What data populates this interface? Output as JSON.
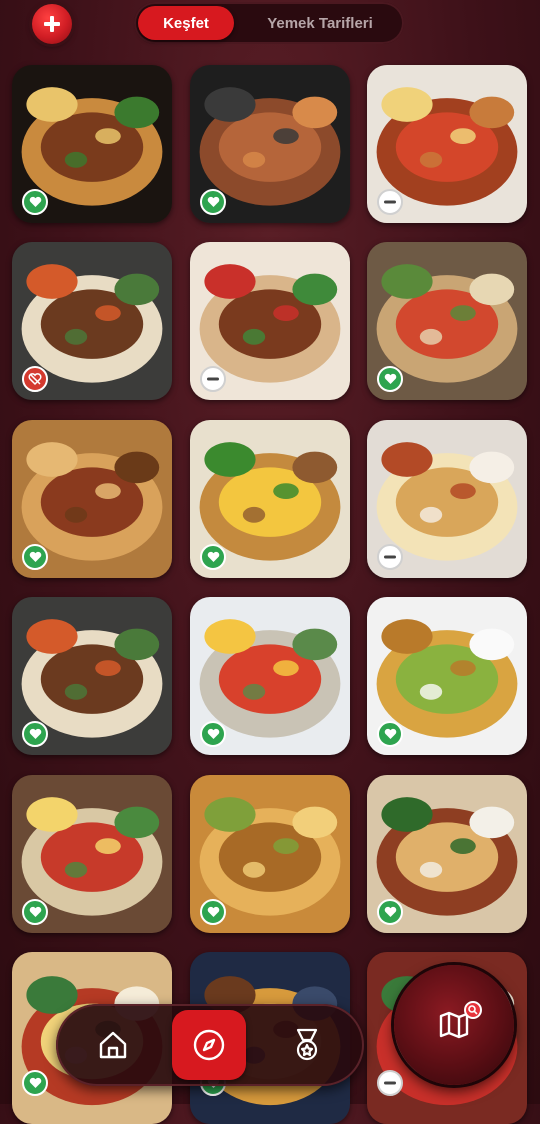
{
  "header": {
    "add_icon": "plus-icon",
    "tabs": [
      {
        "label": "Keşfet",
        "active": true
      },
      {
        "label": "Yemek Tarifleri",
        "active": false
      }
    ]
  },
  "colors": {
    "accent": "#d7191f",
    "background": "#3e1119",
    "favorite": "#2ea44f",
    "disliked": "#d43a2f"
  },
  "cards": [
    {
      "dish": "pide",
      "status": "favorite"
    },
    {
      "dish": "kebab-grill",
      "status": "favorite"
    },
    {
      "dish": "adana-kebab",
      "status": "neutral"
    },
    {
      "dish": "doner-plate",
      "status": "disliked"
    },
    {
      "dish": "wrap",
      "status": "neutral"
    },
    {
      "dish": "meze-table",
      "status": "favorite"
    },
    {
      "dish": "pide-slices",
      "status": "favorite"
    },
    {
      "dish": "chicken-doner",
      "status": "favorite"
    },
    {
      "dish": "hummus",
      "status": "neutral"
    },
    {
      "dish": "doner-plate",
      "status": "favorite"
    },
    {
      "dish": "breakfast-spread",
      "status": "favorite"
    },
    {
      "dish": "baklava",
      "status": "favorite"
    },
    {
      "dish": "breakfast-table",
      "status": "favorite"
    },
    {
      "dish": "baklava-tray",
      "status": "favorite"
    },
    {
      "dish": "lahmacun-pide",
      "status": "favorite"
    },
    {
      "dish": "breakfast-board",
      "status": "favorite"
    },
    {
      "dish": "burger",
      "status": "favorite"
    },
    {
      "dish": "mezes",
      "status": "neutral"
    }
  ],
  "bottom_nav": {
    "items": [
      {
        "icon": "home-icon",
        "active": false
      },
      {
        "icon": "compass-icon",
        "active": true
      },
      {
        "icon": "medal-icon",
        "active": false
      }
    ]
  },
  "map_button": {
    "icon": "map-icon",
    "badge_icon": "search-icon"
  }
}
